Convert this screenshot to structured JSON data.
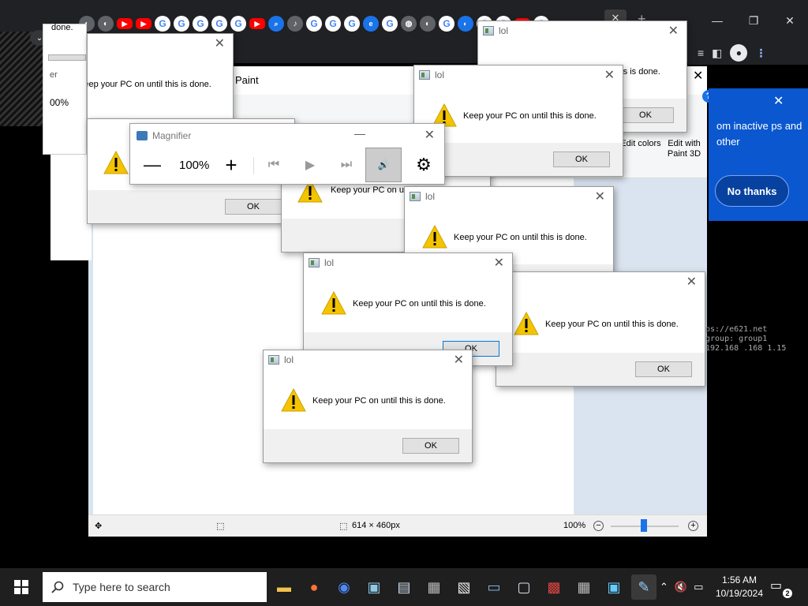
{
  "chrome": {
    "tab_favicons": [
      "chrome",
      "chrome",
      "youtube",
      "youtube",
      "google",
      "google",
      "google",
      "google",
      "google",
      "youtube",
      "search",
      "audio",
      "google",
      "google",
      "google",
      "edge",
      "google",
      "app",
      "chrome",
      "google",
      "chrome",
      "google",
      "google",
      "youtube",
      "google"
    ],
    "tab_close": "✕",
    "new_tab": "+",
    "win_controls": [
      "—",
      "❐",
      "✕"
    ]
  },
  "promo": {
    "text": "om inactive ps and other",
    "button": "No thanks",
    "close": "✕"
  },
  "paint": {
    "title": "Paint",
    "edit_colors": "Edit colors",
    "edit_paint3d": "Edit with Paint 3D",
    "status": {
      "size": "614 × 460px",
      "zoom": "100%"
    }
  },
  "terminal": [
    "ps://e621.net",
    "group: group1",
    "192.168 .168 1.15"
  ],
  "dialog": {
    "title": "lol",
    "message": "Keep your PC on until this is done.",
    "ok": "OK"
  },
  "fragments": {
    "msg_partial": "Keep your PC on until this is done.",
    "zoom_partial": "00%",
    "done_partial": "done.",
    "er_partial": "er"
  },
  "magnifier": {
    "title": "Magnifier",
    "zoom": "100%"
  },
  "taskbar": {
    "search_placeholder": "Type here to search",
    "time": "1:56 AM",
    "date": "10/19/2024",
    "notification_count": "2"
  },
  "colors": {
    "accent": "#0078d7",
    "promo": "#0b57d0",
    "warning": "#f5c400"
  }
}
